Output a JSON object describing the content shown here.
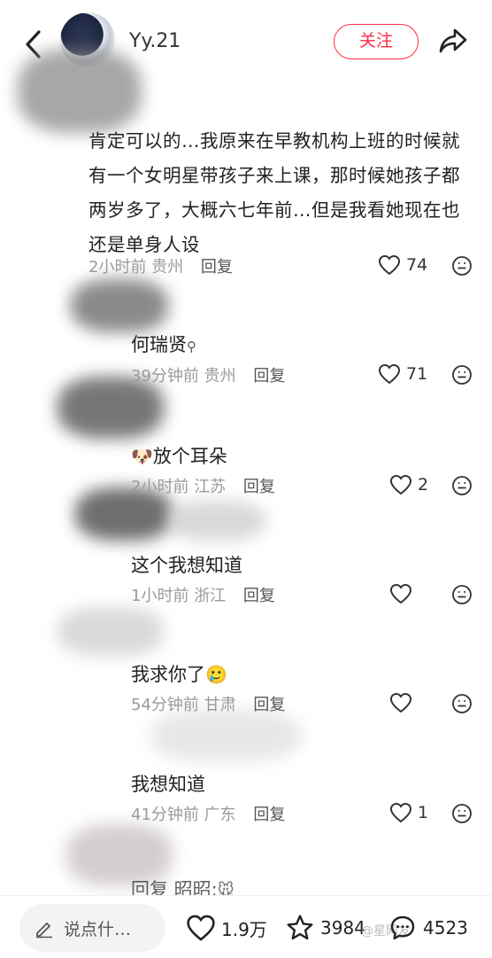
{
  "header": {
    "username": "Yy.21",
    "follow_label": "关注"
  },
  "main_comment": {
    "text": "肯定可以的…我原来在早教机构上班的时候就有一个女明星带孩子来上课，那时候她孩子都两岁多了，大概六七年前…但是我看她现在也还是单身人设",
    "time": "2小时前",
    "location": "贵州",
    "reply_label": "回复",
    "likes": "74"
  },
  "replies": [
    {
      "text": "何瑞贤",
      "time": "39分钟前",
      "location": "贵州",
      "reply_label": "回复",
      "likes": "71"
    },
    {
      "text": "放个耳朵",
      "time": "2小时前",
      "location": "江苏",
      "reply_label": "回复",
      "likes": "2"
    },
    {
      "text": "这个我想知道",
      "time": "1小时前",
      "location": "浙江",
      "reply_label": "回复",
      "likes": ""
    },
    {
      "text": "我求你了",
      "time": "54分钟前",
      "location": "甘肃",
      "reply_label": "回复",
      "likes": ""
    },
    {
      "text": "我想知道",
      "time": "41分钟前",
      "location": "广东",
      "reply_label": "回复",
      "likes": "1"
    },
    {
      "text": "回复 昭昭:",
      "time": "",
      "location": "",
      "reply_label": "",
      "likes": ""
    }
  ],
  "bottom_bar": {
    "input_placeholder": "说点什…",
    "likes": "1.9万",
    "favorites": "3984",
    "comments": "4523",
    "watermark": "@星网友"
  },
  "colors": {
    "accent": "#ff2a44",
    "meta_gray": "#9a9a9a",
    "text": "#222222"
  },
  "icons": [
    "back-icon",
    "share-icon",
    "heart-icon",
    "smile-icon",
    "pencil-icon",
    "star-icon",
    "chat-icon",
    "search-icon"
  ]
}
